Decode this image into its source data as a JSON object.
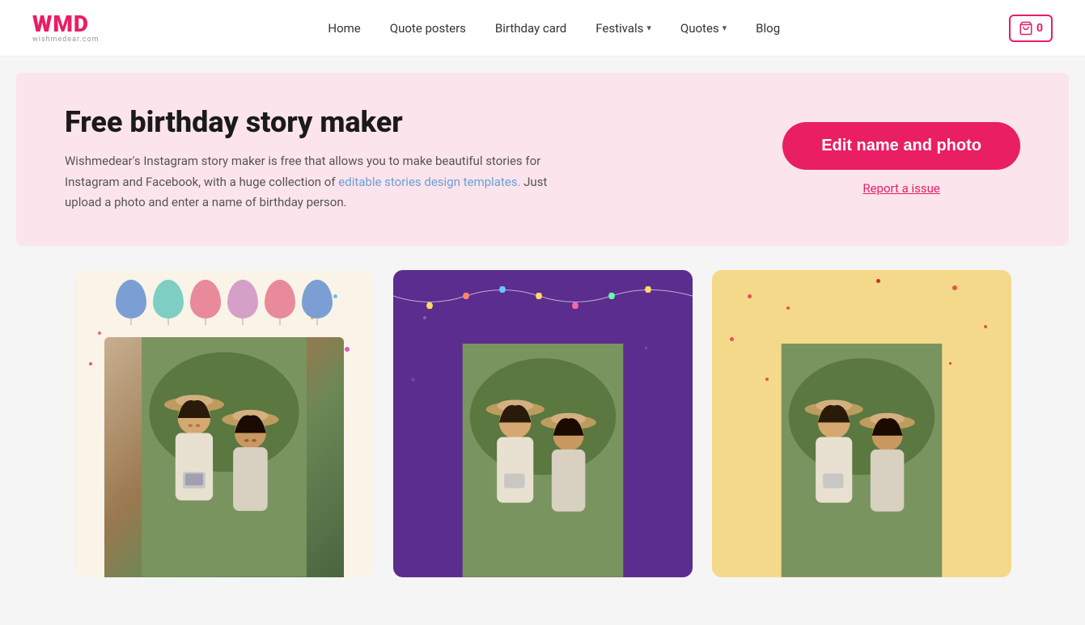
{
  "header": {
    "logo_text": "WMD",
    "logo_sub": "wishmedear.com",
    "nav": [
      {
        "label": "Home",
        "has_dropdown": false
      },
      {
        "label": "Quote posters",
        "has_dropdown": false
      },
      {
        "label": "Birthday card",
        "has_dropdown": false
      },
      {
        "label": "Festivals",
        "has_dropdown": true
      },
      {
        "label": "Quotes",
        "has_dropdown": true
      },
      {
        "label": "Blog",
        "has_dropdown": false
      }
    ],
    "cart_count": "0"
  },
  "hero": {
    "title": "Free birthday story maker",
    "description": "Wishmedear's Instagram story maker is free that allows you to make beautiful stories for Instagram and Facebook, with a huge collection of editable stories design templates. Just upload a photo and enter a name of birthday person.",
    "edit_button": "Edit name and photo",
    "report_link": "Report a issue"
  },
  "cards": [
    {
      "id": 1,
      "bg": "#f9f3e8",
      "style": "balloons"
    },
    {
      "id": 2,
      "bg": "#5b2d8e",
      "style": "garland"
    },
    {
      "id": 3,
      "bg": "#f5d98a",
      "style": "dots"
    }
  ],
  "balloons": [
    {
      "color": "#7b9fd4"
    },
    {
      "color": "#7ecec4"
    },
    {
      "color": "#e88a9a"
    },
    {
      "color": "#d4a0c8"
    },
    {
      "color": "#e88a9a"
    },
    {
      "color": "#7b9fd4"
    }
  ]
}
